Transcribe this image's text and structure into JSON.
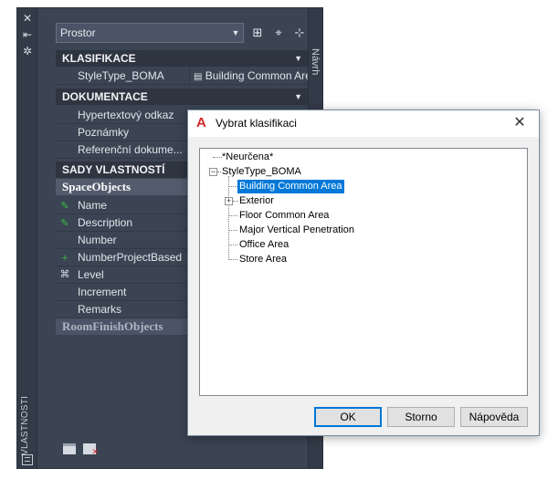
{
  "palette": {
    "side_label": "VLASTNOSTI",
    "right_tab": "Návrh",
    "selector_value": "Prostor",
    "categories": {
      "klasifikace": "KLASIFIKACE",
      "dokumentace": "DOKUMENTACE",
      "sady": "SADY VLASTNOSTÍ"
    },
    "classification_row": {
      "name": "StyleType_BOMA",
      "value": "Building Common Area"
    },
    "documentation_rows": [
      "Hypertextový odkaz",
      "Poznámky",
      "Referenční dokume..."
    ],
    "space_objects": {
      "title": "SpaceObjects",
      "rows": [
        "Name",
        "Description",
        "Number",
        "NumberProjectBased",
        "Level",
        "Increment",
        "Remarks"
      ]
    },
    "room_finish": "RoomFinishObjects"
  },
  "dialog": {
    "title": "Vybrat klasifikaci",
    "tree": {
      "unspecified": "*Neurčena*",
      "root": "StyleType_BOMA",
      "children": [
        "Building Common Area",
        "Exterior",
        "Floor Common Area",
        "Major Vertical Penetration",
        "Office Area",
        "Store Area"
      ]
    },
    "buttons": {
      "ok": "OK",
      "cancel": "Storno",
      "help": "Nápověda"
    }
  }
}
